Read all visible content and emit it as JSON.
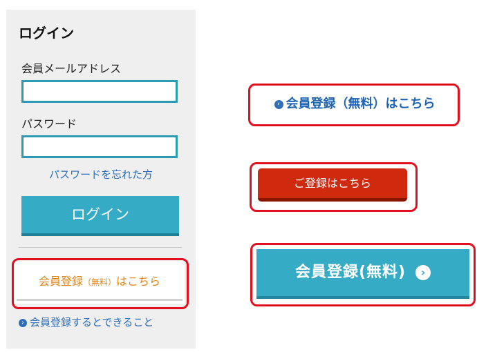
{
  "login_panel": {
    "title": "ログイン",
    "email_label": "会員メールアドレス",
    "email_value": "",
    "password_label": "パスワード",
    "password_value": "",
    "forgot_link": "パスワードを忘れた方",
    "login_button": "ログイン",
    "register_main": "会員登録",
    "register_paren": "（無料）",
    "register_suffix": "はこちら",
    "benefit_link": "会員登録するとできること"
  },
  "variants": {
    "text_link": "会員登録（無料）はこちら",
    "red_button": "ご登録はこちら",
    "teal_button": "会員登録(無料)"
  },
  "icons": {
    "arrow_circle": "chevron-right-circle-icon"
  },
  "colors": {
    "accent_teal": "#35abc6",
    "highlight_red": "#e10f1f",
    "cta_red": "#cf2a0e",
    "link_blue": "#2f6fba",
    "register_orange": "#e08619"
  }
}
